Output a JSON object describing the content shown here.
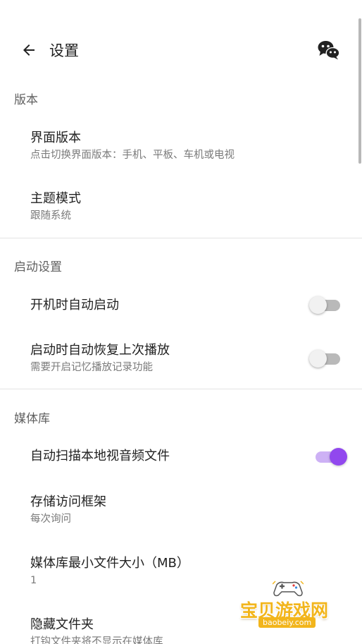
{
  "app_bar": {
    "title": "设置",
    "back_icon": "arrow-back-icon",
    "action_icon": "wechat-icon"
  },
  "sections": {
    "version": {
      "header": "版本",
      "items": [
        {
          "title": "界面版本",
          "summary": "点击切换界面版本：手机、平板、车机或电视"
        },
        {
          "title": "主题模式",
          "summary": "跟随系统"
        }
      ]
    },
    "startup": {
      "header": "启动设置",
      "items": [
        {
          "title": "开机时自动启动",
          "switch_on": false
        },
        {
          "title": "启动时自动恢复上次播放",
          "summary": "需要开启记忆播放记录功能",
          "switch_on": false
        }
      ]
    },
    "media": {
      "header": "媒体库",
      "items": [
        {
          "title": "自动扫描本地视音频文件",
          "switch_on": true
        },
        {
          "title": "存储访问框架",
          "summary": "每次询问"
        },
        {
          "title": "媒体库最小文件大小（MB）",
          "summary": "1"
        },
        {
          "title": "隐藏文件夹",
          "summary": "打钩文件夹将不显示在媒体库"
        }
      ]
    }
  },
  "watermark": {
    "text": "宝贝游戏网",
    "domain": "baobeiy.com"
  },
  "colors": {
    "accent": "#9148ee",
    "accent_track": "#cdb1f5",
    "switch_off_track": "#b9b9b9",
    "switch_off_thumb": "#f1f1f1",
    "section_header": "#606060",
    "summary_text": "#7a7a7a",
    "watermark": "#f2b51c"
  }
}
